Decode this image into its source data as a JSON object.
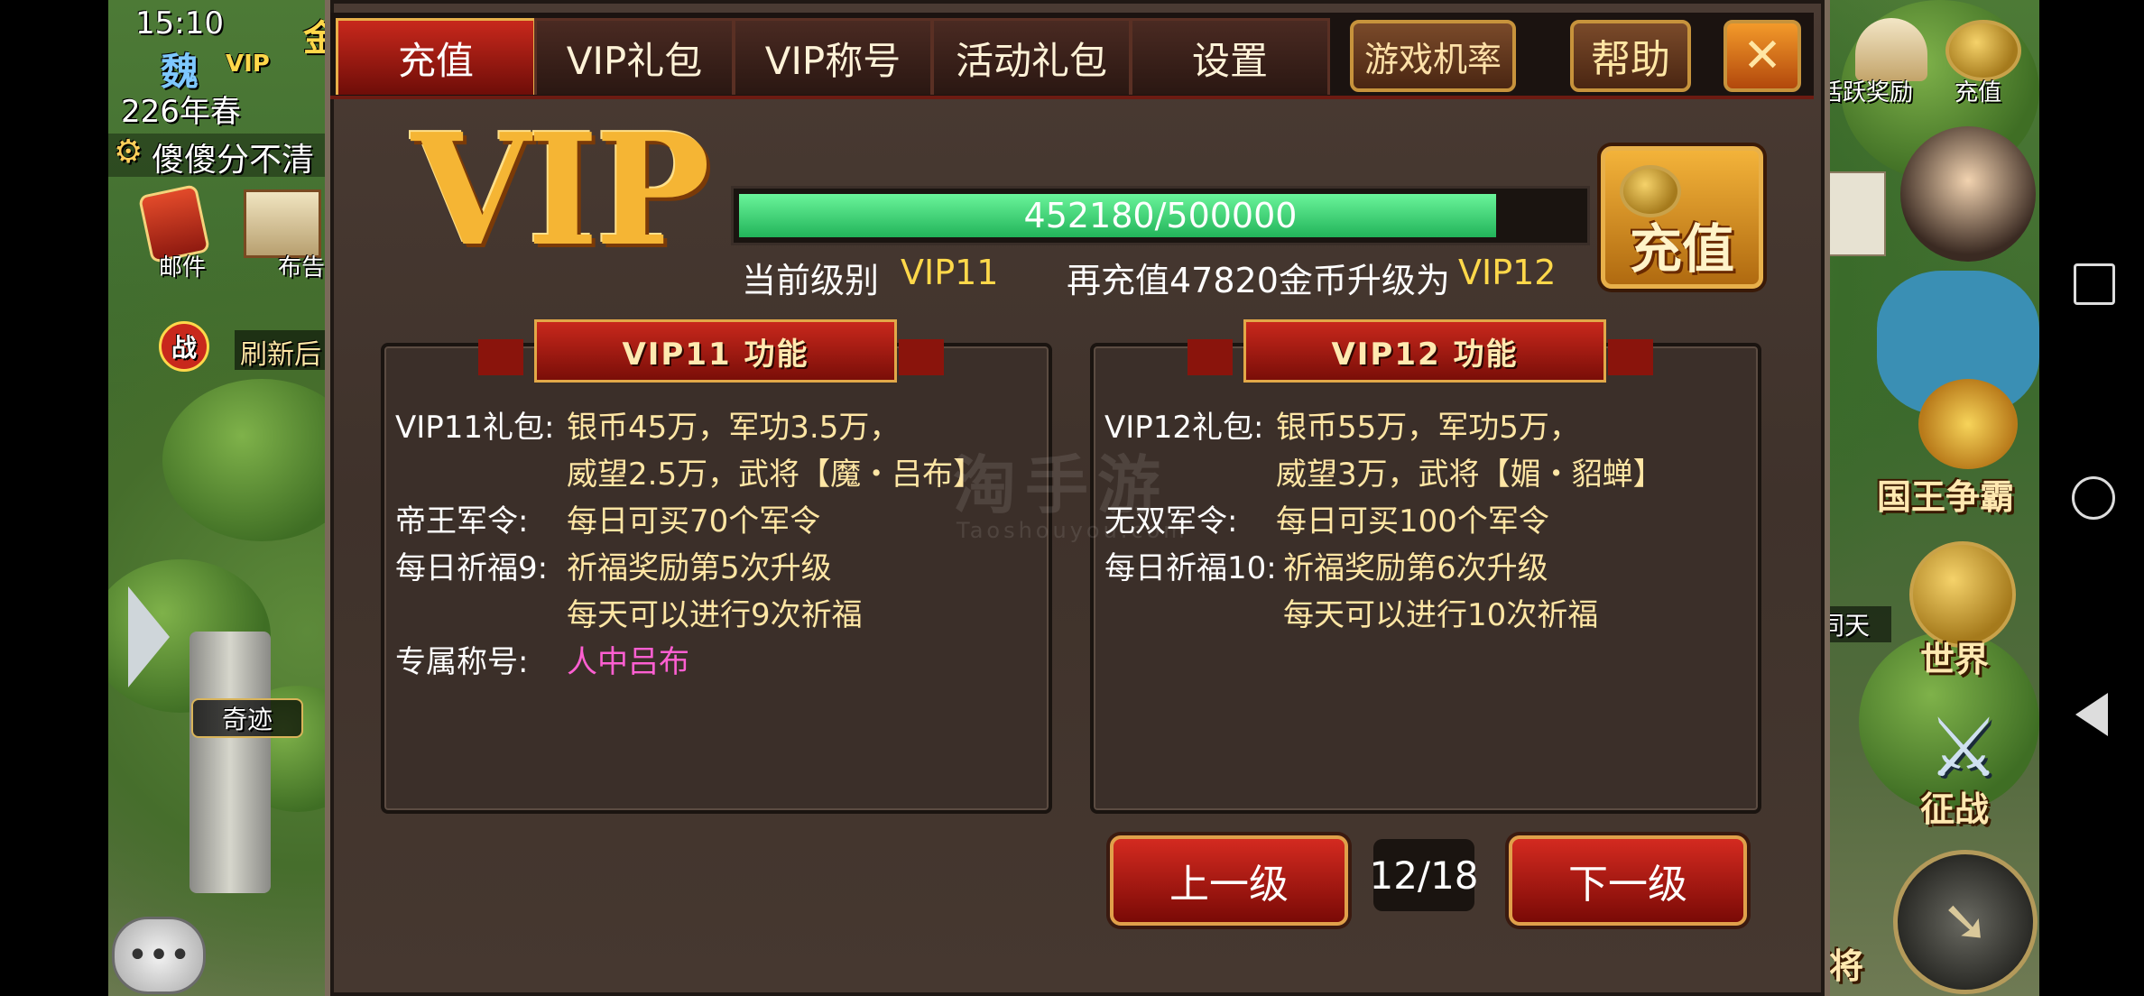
{
  "status_bar": {
    "time": "15:10"
  },
  "hud_left": {
    "kingdom": "魏",
    "vip_badge": "VIP",
    "season": "226年春",
    "player_name": "傻傻分不清",
    "mail_label": "邮件",
    "notice_label": "布告",
    "battle_label": "战",
    "refresh_text": "刷新后",
    "wonder_label": "奇迹",
    "right_cut_label": "金"
  },
  "hud_right": {
    "active_reward_label": "活跃奖励",
    "recharge_label": "充值",
    "king_contest_label": "国王争霸",
    "world_label": "世界",
    "campaign_label": "征战",
    "same_day_label": "同天",
    "general_label": "将"
  },
  "dialog": {
    "tabs": [
      {
        "label": "充值",
        "active": true
      },
      {
        "label": "VIP礼包",
        "active": false
      },
      {
        "label": "VIP称号",
        "active": false
      },
      {
        "label": "活动礼包",
        "active": false
      },
      {
        "label": "设置",
        "active": false
      }
    ],
    "odds_button": "游戏机率",
    "help_button": "帮助",
    "close_button": "✕",
    "vip_logo": "VIP",
    "progress": {
      "text": "452180/500000",
      "current": 452180,
      "max": 500000
    },
    "current_level_label": "当前级别",
    "current_level_value": "VIP11",
    "upgrade_text": "再充值47820金币升级为",
    "next_level_value": "VIP12",
    "recharge_button": "充值",
    "left_panel": {
      "title": "VIP11  功能",
      "rows": [
        {
          "label": "VIP11礼包:",
          "value": "银币45万，军功3.5万，"
        },
        {
          "label": "",
          "value": "威望2.5万，武将【魔・吕布】"
        },
        {
          "label": "帝王军令:",
          "value": "每日可买70个军令"
        },
        {
          "label": "每日祈福9:",
          "value": "祈福奖励第5次升级"
        },
        {
          "label": "",
          "value": "每天可以进行9次祈福"
        },
        {
          "label": "专属称号:",
          "value": "人中吕布"
        }
      ]
    },
    "right_panel": {
      "title": "VIP12  功能",
      "rows": [
        {
          "label": "VIP12礼包:",
          "value": "银币55万，军功5万，"
        },
        {
          "label": "",
          "value": "威望3万，武将【媚・貂蝉】"
        },
        {
          "label": "无双军令:",
          "value": "每日可买100个军令"
        },
        {
          "label": "每日祈福10:",
          "value": "祈福奖励第6次升级"
        },
        {
          "label": "",
          "value": "每天可以进行10次祈福"
        }
      ]
    },
    "prev_button": "上一级",
    "page_indicator": "12/18",
    "next_button": "下一级"
  },
  "watermark": {
    "main": "淘手游",
    "sub": "Taoshouyou.com"
  },
  "colors": {
    "accent_red": "#c8281c",
    "gold": "#ffd84a",
    "progress_green": "#2fd46a",
    "title_pink": "#ff5fd2"
  }
}
